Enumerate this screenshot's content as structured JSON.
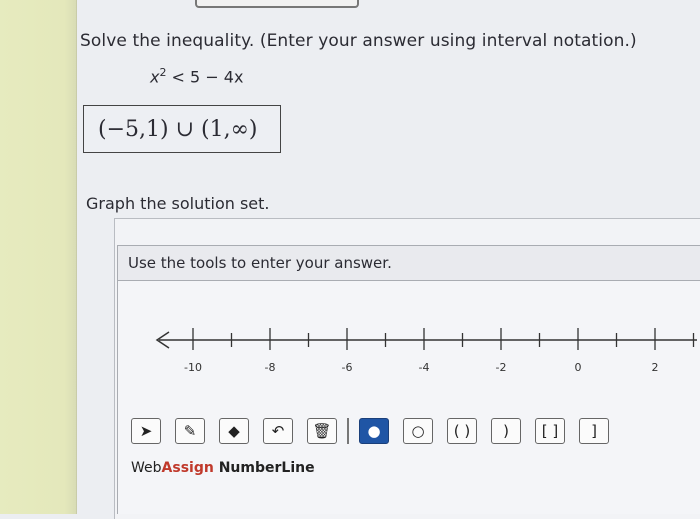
{
  "question": {
    "prompt": "Solve the inequality. (Enter your answer using interval notation.)",
    "inequality_lhs": "x",
    "inequality_exp": "2",
    "inequality_rhs": " < 5 − 4x",
    "answer": "(−5,1) ∪ (1,∞)"
  },
  "graph": {
    "label": "Graph the solution set.",
    "instructions": "Use the tools to enter your answer.",
    "tick_labels": [
      "-10",
      "-8",
      "-6",
      "-4",
      "-2",
      "0",
      "2"
    ]
  },
  "toolbar": {
    "tools": [
      {
        "name": "pointer-icon",
        "glyph": "➤"
      },
      {
        "name": "pencil-icon",
        "glyph": "✎"
      },
      {
        "name": "eraser-icon",
        "glyph": "◆"
      },
      {
        "name": "undo-icon",
        "glyph": "↶"
      },
      {
        "name": "trash-icon",
        "glyph": "🗑"
      },
      {
        "name": "closed-point-icon",
        "glyph": "●"
      },
      {
        "name": "open-point-icon",
        "glyph": "○"
      },
      {
        "name": "open-interval-icon",
        "glyph": "( )"
      },
      {
        "name": "open-closed-interval-icon",
        "glyph": ")"
      },
      {
        "name": "closed-interval-icon",
        "glyph": "[ ]"
      },
      {
        "name": "closed-open-interval-icon",
        "glyph": "]"
      }
    ]
  },
  "brand": {
    "web": "Web",
    "assign": "Assign",
    "product": " NumberLine"
  }
}
